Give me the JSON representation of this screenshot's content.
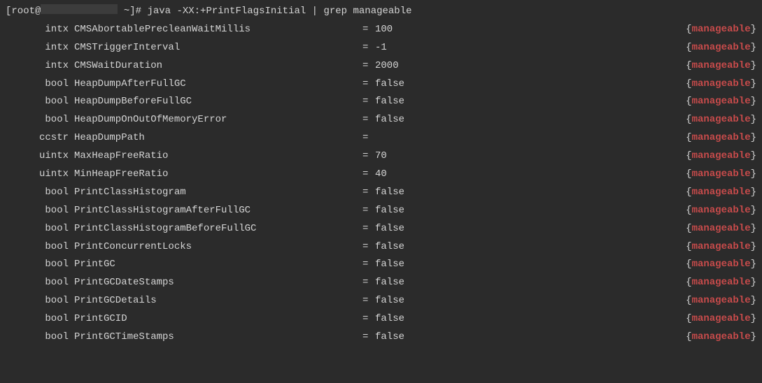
{
  "prompt": {
    "user_host_prefix": "[root@",
    "user_host_suffix": " ~]# ",
    "command": "java -XX:+PrintFlagsInitial | grep manageable"
  },
  "tag_label": "manageable",
  "flags": [
    {
      "type": "intx",
      "name": "CMSAbortablePrecleanWaitMillis",
      "value": "100"
    },
    {
      "type": "intx",
      "name": "CMSTriggerInterval",
      "value": "-1"
    },
    {
      "type": "intx",
      "name": "CMSWaitDuration",
      "value": "2000"
    },
    {
      "type": "bool",
      "name": "HeapDumpAfterFullGC",
      "value": "false"
    },
    {
      "type": "bool",
      "name": "HeapDumpBeforeFullGC",
      "value": "false"
    },
    {
      "type": "bool",
      "name": "HeapDumpOnOutOfMemoryError",
      "value": "false"
    },
    {
      "type": "ccstr",
      "name": "HeapDumpPath",
      "value": ""
    },
    {
      "type": "uintx",
      "name": "MaxHeapFreeRatio",
      "value": "70"
    },
    {
      "type": "uintx",
      "name": "MinHeapFreeRatio",
      "value": "40"
    },
    {
      "type": "bool",
      "name": "PrintClassHistogram",
      "value": "false"
    },
    {
      "type": "bool",
      "name": "PrintClassHistogramAfterFullGC",
      "value": "false"
    },
    {
      "type": "bool",
      "name": "PrintClassHistogramBeforeFullGC",
      "value": "false"
    },
    {
      "type": "bool",
      "name": "PrintConcurrentLocks",
      "value": "false"
    },
    {
      "type": "bool",
      "name": "PrintGC",
      "value": "false"
    },
    {
      "type": "bool",
      "name": "PrintGCDateStamps",
      "value": "false"
    },
    {
      "type": "bool",
      "name": "PrintGCDetails",
      "value": "false"
    },
    {
      "type": "bool",
      "name": "PrintGCID",
      "value": "false"
    },
    {
      "type": "bool",
      "name": "PrintGCTimeStamps",
      "value": "false"
    }
  ]
}
